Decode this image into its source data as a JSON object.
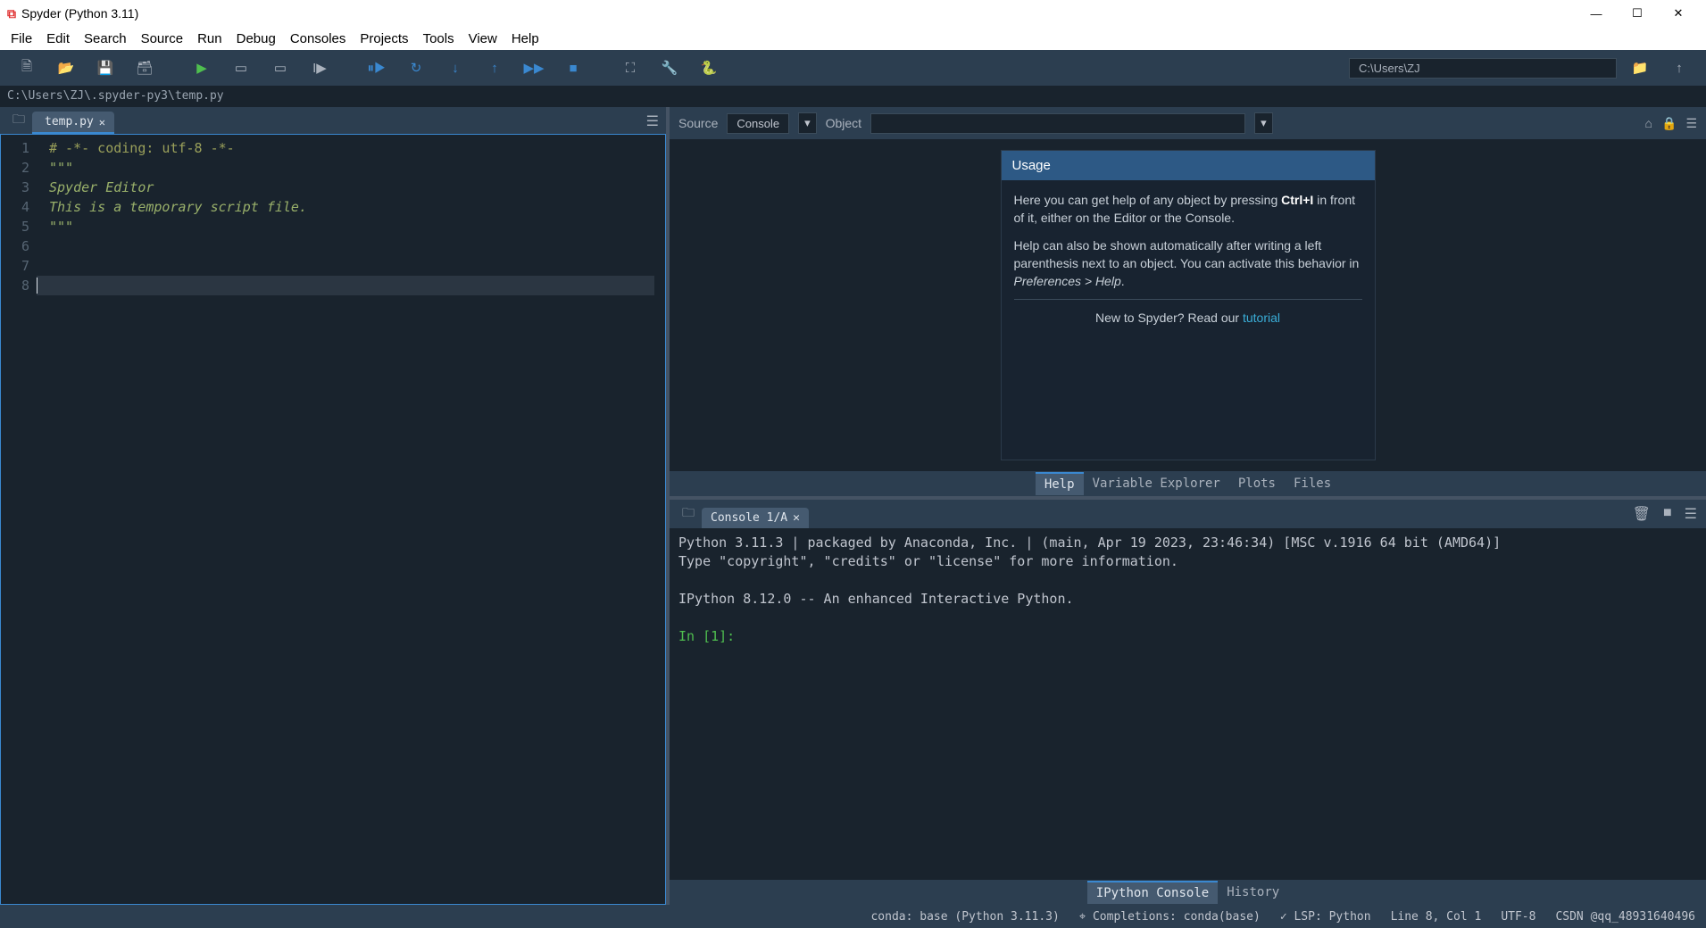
{
  "window": {
    "title": "Spyder (Python 3.11)"
  },
  "menu": [
    "File",
    "Edit",
    "Search",
    "Source",
    "Run",
    "Debug",
    "Consoles",
    "Projects",
    "Tools",
    "View",
    "Help"
  ],
  "toolbar": {
    "cwd": "C:\\Users\\ZJ"
  },
  "pathbar": "C:\\Users\\ZJ\\.spyder-py3\\temp.py",
  "editor": {
    "tab_name": "temp.py",
    "lines": [
      "# -*- coding: utf-8 -*-",
      "\"\"\"",
      "Spyder Editor",
      "",
      "This is a temporary script file.",
      "\"\"\"",
      "",
      ""
    ]
  },
  "help_header": {
    "source_label": "Source",
    "source_value": "Console",
    "object_label": "Object",
    "object_value": ""
  },
  "help_card": {
    "title": "Usage",
    "p1_pre": "Here you can get help of any object by pressing ",
    "p1_kb": "Ctrl+I",
    "p1_post": " in front of it, either on the Editor or the Console.",
    "p2_pre": "Help can also be shown automatically after writing a left parenthesis next to an object. You can activate this behavior in ",
    "p2_em": "Preferences > Help",
    "p2_post": ".",
    "p3_pre": "New to Spyder? Read our ",
    "p3_link": "tutorial"
  },
  "help_tabs": [
    "Help",
    "Variable Explorer",
    "Plots",
    "Files"
  ],
  "console": {
    "tab_name": "Console 1/A",
    "banner": "Python 3.11.3 | packaged by Anaconda, Inc. | (main, Apr 19 2023, 23:46:34) [MSC v.1916 64 bit (AMD64)]\nType \"copyright\", \"credits\" or \"license\" for more information.\n\nIPython 8.12.0 -- An enhanced Interactive Python.\n",
    "prompt": "In [1]: "
  },
  "console_tabs": [
    "IPython Console",
    "History"
  ],
  "status": {
    "conda": "conda: base (Python 3.11.3)",
    "completions": "Completions: conda(base)",
    "lsp": "LSP: Python",
    "pos": "Line 8, Col 1",
    "enc": "UTF-8",
    "suffix": "CSDN @qq_48931640496"
  }
}
